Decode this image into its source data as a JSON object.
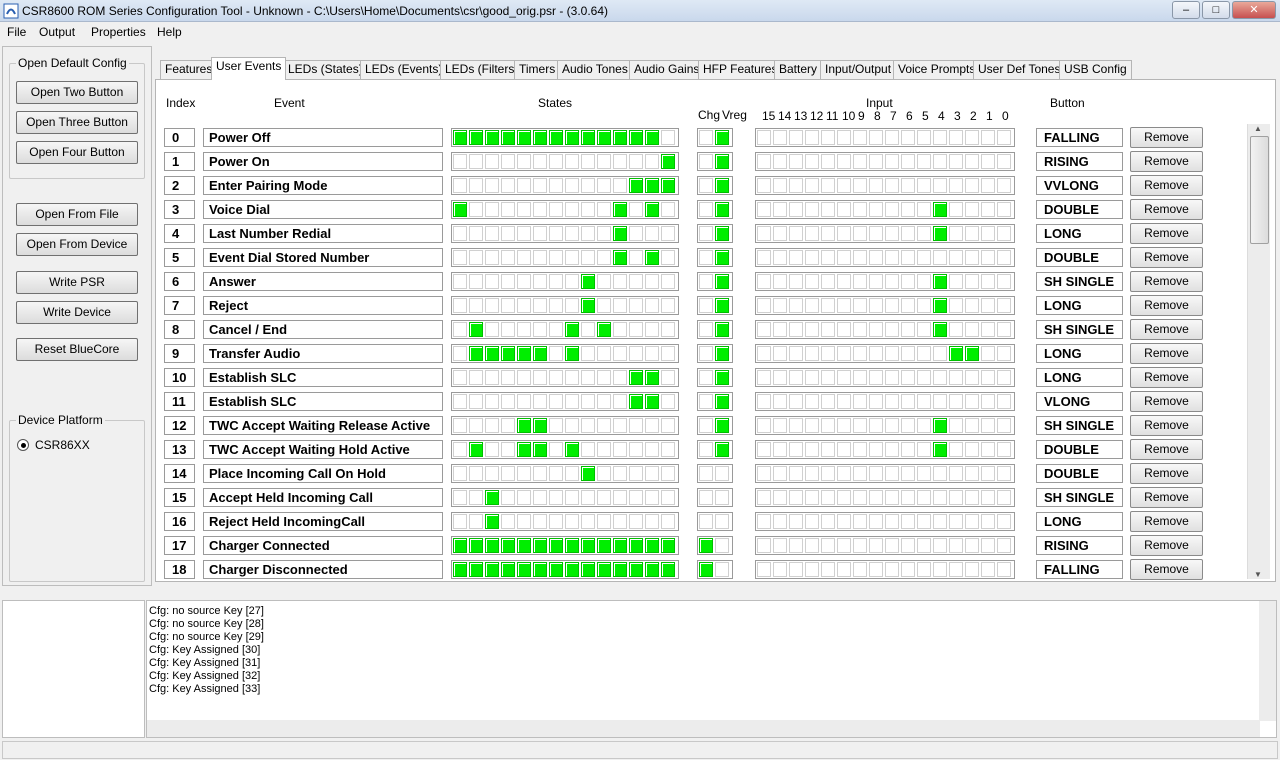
{
  "window": {
    "title": "CSR8600 ROM Series Configuration Tool - Unknown - C:\\Users\\Home\\Documents\\csr\\good_orig.psr - (3.0.64)",
    "minimize": "–",
    "maximize": "□",
    "close": "✕"
  },
  "menu": [
    "File",
    "Output",
    "Properties",
    "Help"
  ],
  "left": {
    "default_config_label": "Open Default Config",
    "open_two": "Open Two Button",
    "open_three": "Open Three Button",
    "open_four": "Open Four Button",
    "open_from_file": "Open From File",
    "open_from_device": "Open From Device",
    "write_psr": "Write PSR",
    "write_device": "Write Device",
    "reset_bluecore": "Reset BlueCore",
    "device_platform_label": "Device Platform",
    "platform_option": "CSR86XX"
  },
  "tabs": [
    "Features",
    "User Events",
    "LEDs (States)",
    "LEDs (Events)",
    "LEDs (Filters)",
    "Timers",
    "Audio Tones",
    "Audio Gains",
    "HFP Features",
    "Battery",
    "Input/Output",
    "Voice Prompts",
    "User Def Tones",
    "USB Config"
  ],
  "active_tab": "User Events",
  "headers": {
    "index": "Index",
    "event": "Event",
    "states": "States",
    "chg": "Chg",
    "vreg": "Vreg",
    "input": "Input",
    "button": "Button",
    "input_bits": [
      "15",
      "14",
      "13",
      "12",
      "11",
      "10",
      "9",
      "8",
      "7",
      "6",
      "5",
      "4",
      "3",
      "2",
      "1",
      "0"
    ]
  },
  "remove_label": "Remove",
  "rows": [
    {
      "index": "0",
      "event": "Power Off",
      "states": [
        1,
        1,
        1,
        1,
        1,
        1,
        1,
        1,
        1,
        1,
        1,
        1,
        1,
        0
      ],
      "chg": [
        0,
        1
      ],
      "input": [
        0,
        0,
        0,
        0,
        0,
        0,
        0,
        0,
        0,
        0,
        0,
        0,
        0,
        0,
        0,
        0
      ],
      "button": "FALLING"
    },
    {
      "index": "1",
      "event": "Power On",
      "states": [
        0,
        0,
        0,
        0,
        0,
        0,
        0,
        0,
        0,
        0,
        0,
        0,
        0,
        1
      ],
      "chg": [
        0,
        1
      ],
      "input": [
        0,
        0,
        0,
        0,
        0,
        0,
        0,
        0,
        0,
        0,
        0,
        0,
        0,
        0,
        0,
        0
      ],
      "button": "RISING"
    },
    {
      "index": "2",
      "event": "Enter Pairing Mode",
      "states": [
        0,
        0,
        0,
        0,
        0,
        0,
        0,
        0,
        0,
        0,
        0,
        1,
        1,
        1
      ],
      "chg": [
        0,
        1
      ],
      "input": [
        0,
        0,
        0,
        0,
        0,
        0,
        0,
        0,
        0,
        0,
        0,
        0,
        0,
        0,
        0,
        0
      ],
      "button": "VVLONG"
    },
    {
      "index": "3",
      "event": "Voice Dial",
      "states": [
        1,
        0,
        0,
        0,
        0,
        0,
        0,
        0,
        0,
        0,
        1,
        0,
        1,
        0
      ],
      "chg": [
        0,
        1
      ],
      "input": [
        0,
        0,
        0,
        0,
        0,
        0,
        0,
        0,
        0,
        0,
        0,
        1,
        0,
        0,
        0,
        0
      ],
      "button": "DOUBLE"
    },
    {
      "index": "4",
      "event": "Last Number Redial",
      "states": [
        0,
        0,
        0,
        0,
        0,
        0,
        0,
        0,
        0,
        0,
        1,
        0,
        0,
        0
      ],
      "chg": [
        0,
        1
      ],
      "input": [
        0,
        0,
        0,
        0,
        0,
        0,
        0,
        0,
        0,
        0,
        0,
        1,
        0,
        0,
        0,
        0
      ],
      "button": "LONG"
    },
    {
      "index": "5",
      "event": "Event Dial Stored Number",
      "states": [
        0,
        0,
        0,
        0,
        0,
        0,
        0,
        0,
        0,
        0,
        1,
        0,
        1,
        0
      ],
      "chg": [
        0,
        1
      ],
      "input": [
        0,
        0,
        0,
        0,
        0,
        0,
        0,
        0,
        0,
        0,
        0,
        0,
        0,
        0,
        0,
        0
      ],
      "button": "DOUBLE"
    },
    {
      "index": "6",
      "event": "Answer",
      "states": [
        0,
        0,
        0,
        0,
        0,
        0,
        0,
        0,
        1,
        0,
        0,
        0,
        0,
        0
      ],
      "chg": [
        0,
        1
      ],
      "input": [
        0,
        0,
        0,
        0,
        0,
        0,
        0,
        0,
        0,
        0,
        0,
        1,
        0,
        0,
        0,
        0
      ],
      "button": "SH SINGLE"
    },
    {
      "index": "7",
      "event": "Reject",
      "states": [
        0,
        0,
        0,
        0,
        0,
        0,
        0,
        0,
        1,
        0,
        0,
        0,
        0,
        0
      ],
      "chg": [
        0,
        1
      ],
      "input": [
        0,
        0,
        0,
        0,
        0,
        0,
        0,
        0,
        0,
        0,
        0,
        1,
        0,
        0,
        0,
        0
      ],
      "button": "LONG"
    },
    {
      "index": "8",
      "event": "Cancel / End",
      "states": [
        0,
        1,
        0,
        0,
        0,
        0,
        0,
        1,
        0,
        1,
        0,
        0,
        0,
        0
      ],
      "chg": [
        0,
        1
      ],
      "input": [
        0,
        0,
        0,
        0,
        0,
        0,
        0,
        0,
        0,
        0,
        0,
        1,
        0,
        0,
        0,
        0
      ],
      "button": "SH SINGLE"
    },
    {
      "index": "9",
      "event": "Transfer Audio",
      "states": [
        0,
        1,
        1,
        1,
        1,
        1,
        0,
        1,
        0,
        0,
        0,
        0,
        0,
        0
      ],
      "chg": [
        0,
        1
      ],
      "input": [
        0,
        0,
        0,
        0,
        0,
        0,
        0,
        0,
        0,
        0,
        0,
        0,
        1,
        1,
        0,
        0
      ],
      "button": "LONG"
    },
    {
      "index": "10",
      "event": "Establish SLC",
      "states": [
        0,
        0,
        0,
        0,
        0,
        0,
        0,
        0,
        0,
        0,
        0,
        1,
        1,
        0
      ],
      "chg": [
        0,
        1
      ],
      "input": [
        0,
        0,
        0,
        0,
        0,
        0,
        0,
        0,
        0,
        0,
        0,
        0,
        0,
        0,
        0,
        0
      ],
      "button": "LONG"
    },
    {
      "index": "11",
      "event": "Establish SLC",
      "states": [
        0,
        0,
        0,
        0,
        0,
        0,
        0,
        0,
        0,
        0,
        0,
        1,
        1,
        0
      ],
      "chg": [
        0,
        1
      ],
      "input": [
        0,
        0,
        0,
        0,
        0,
        0,
        0,
        0,
        0,
        0,
        0,
        0,
        0,
        0,
        0,
        0
      ],
      "button": "VLONG"
    },
    {
      "index": "12",
      "event": "TWC Accept Waiting Release Active",
      "states": [
        0,
        0,
        0,
        0,
        1,
        1,
        0,
        0,
        0,
        0,
        0,
        0,
        0,
        0
      ],
      "chg": [
        0,
        1
      ],
      "input": [
        0,
        0,
        0,
        0,
        0,
        0,
        0,
        0,
        0,
        0,
        0,
        1,
        0,
        0,
        0,
        0
      ],
      "button": "SH SINGLE"
    },
    {
      "index": "13",
      "event": "TWC Accept Waiting Hold Active",
      "states": [
        0,
        1,
        0,
        0,
        1,
        1,
        0,
        1,
        0,
        0,
        0,
        0,
        0,
        0
      ],
      "chg": [
        0,
        1
      ],
      "input": [
        0,
        0,
        0,
        0,
        0,
        0,
        0,
        0,
        0,
        0,
        0,
        1,
        0,
        0,
        0,
        0
      ],
      "button": "DOUBLE"
    },
    {
      "index": "14",
      "event": "Place Incoming Call On Hold",
      "states": [
        0,
        0,
        0,
        0,
        0,
        0,
        0,
        0,
        1,
        0,
        0,
        0,
        0,
        0
      ],
      "chg": [
        0,
        0
      ],
      "input": [
        0,
        0,
        0,
        0,
        0,
        0,
        0,
        0,
        0,
        0,
        0,
        0,
        0,
        0,
        0,
        0
      ],
      "button": "DOUBLE"
    },
    {
      "index": "15",
      "event": "Accept Held Incoming Call",
      "states": [
        0,
        0,
        1,
        0,
        0,
        0,
        0,
        0,
        0,
        0,
        0,
        0,
        0,
        0
      ],
      "chg": [
        0,
        0
      ],
      "input": [
        0,
        0,
        0,
        0,
        0,
        0,
        0,
        0,
        0,
        0,
        0,
        0,
        0,
        0,
        0,
        0
      ],
      "button": "SH SINGLE"
    },
    {
      "index": "16",
      "event": "Reject Held IncomingCall",
      "states": [
        0,
        0,
        1,
        0,
        0,
        0,
        0,
        0,
        0,
        0,
        0,
        0,
        0,
        0
      ],
      "chg": [
        0,
        0
      ],
      "input": [
        0,
        0,
        0,
        0,
        0,
        0,
        0,
        0,
        0,
        0,
        0,
        0,
        0,
        0,
        0,
        0
      ],
      "button": "LONG"
    },
    {
      "index": "17",
      "event": "Charger Connected",
      "states": [
        1,
        1,
        1,
        1,
        1,
        1,
        1,
        1,
        1,
        1,
        1,
        1,
        1,
        1
      ],
      "chg": [
        1,
        0
      ],
      "input": [
        0,
        0,
        0,
        0,
        0,
        0,
        0,
        0,
        0,
        0,
        0,
        0,
        0,
        0,
        0,
        0
      ],
      "button": "RISING"
    },
    {
      "index": "18",
      "event": "Charger Disconnected",
      "states": [
        1,
        1,
        1,
        1,
        1,
        1,
        1,
        1,
        1,
        1,
        1,
        1,
        1,
        1
      ],
      "chg": [
        1,
        0
      ],
      "input": [
        0,
        0,
        0,
        0,
        0,
        0,
        0,
        0,
        0,
        0,
        0,
        0,
        0,
        0,
        0,
        0
      ],
      "button": "FALLING"
    }
  ],
  "log": [
    "Cfg: no source Key [27]",
    "Cfg: no source Key [28]",
    "Cfg: no source Key [29]",
    "Cfg: Key Assigned [30]",
    "Cfg: Key Assigned [31]",
    "Cfg: Key Assigned [32]",
    "Cfg: Key Assigned [33]"
  ],
  "colors": {
    "on": "#00ee00",
    "accent": "#2a5fb0"
  }
}
